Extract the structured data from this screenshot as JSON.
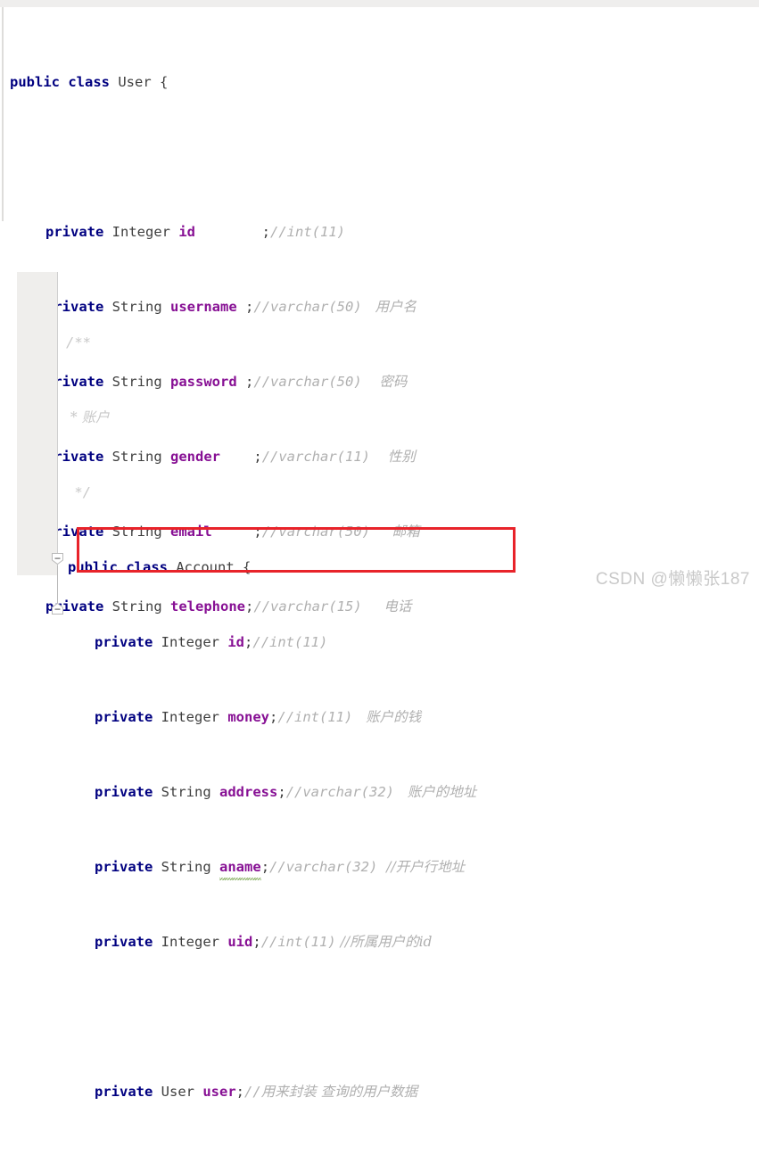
{
  "editor": {
    "language": "java",
    "watermark": "CSDN @懒懒张187",
    "accent_highlight_color": "#e8232a",
    "keyword_color": "#000080",
    "field_color": "#871094",
    "comment_color": "#b0b0b0",
    "gutter_color": "#efeeec"
  },
  "blocks": [
    {
      "id": "user-class",
      "class_name": "User",
      "lines": [
        {
          "id": "u-decl",
          "indent": 0,
          "keyword": "public class",
          "name": "User",
          "brace": " {"
        },
        {
          "id": "u-blank",
          "indent": 0,
          "text": ""
        },
        {
          "id": "u-id",
          "indent": 1,
          "keyword": "private",
          "type": "Integer",
          "field": "id",
          "pad": "        ",
          "semi": ";",
          "comment": "//int(11)",
          "comment_cn": ""
        },
        {
          "id": "u-username",
          "indent": 1,
          "keyword": "private",
          "type": "String",
          "field": "username",
          "pad": " ",
          "semi": ";",
          "comment": "//varchar(50)",
          "comment_cn": "用户名"
        },
        {
          "id": "u-password",
          "indent": 1,
          "keyword": "private",
          "type": "String",
          "field": "password",
          "pad": " ",
          "semi": ";",
          "comment": "//varchar(50)",
          "comment_cn": "密码"
        },
        {
          "id": "u-gender",
          "indent": 1,
          "keyword": "private",
          "type": "String",
          "field": "gender",
          "pad": "    ",
          "semi": ";",
          "comment": "//varchar(11)",
          "comment_cn": "性别"
        },
        {
          "id": "u-email",
          "indent": 1,
          "keyword": "private",
          "type": "String",
          "field": "email",
          "pad": "     ",
          "semi": ";",
          "comment": "//varchar(50)",
          "comment_cn": "邮箱"
        },
        {
          "id": "u-telephone",
          "indent": 1,
          "keyword": "private",
          "type": "String",
          "field": "telephone",
          "pad": "",
          "semi": ";",
          "comment": "//varchar(15)",
          "comment_cn": "电话"
        }
      ]
    },
    {
      "id": "account-class",
      "class_name": "Account",
      "javadoc": [
        "/**",
        " * 账户",
        " */"
      ],
      "fold_markers": [
        {
          "id": "fold-open",
          "type": "fold-open-icon",
          "state": "expanded"
        },
        {
          "id": "fold-close",
          "type": "fold-close-icon",
          "state": "expanded"
        }
      ],
      "lines": [
        {
          "id": "a-decl",
          "indent": 0,
          "keyword": "public class",
          "name": "Account",
          "brace": " {"
        },
        {
          "id": "a-id",
          "indent": 1,
          "keyword": "private",
          "type": "Integer",
          "field": "id",
          "semi": ";",
          "comment": "//int(11)",
          "comment_cn": ""
        },
        {
          "id": "a-money",
          "indent": 1,
          "keyword": "private",
          "type": "Integer",
          "field": "money",
          "semi": ";",
          "comment": "//int(11)",
          "comment_cn": "账户的钱"
        },
        {
          "id": "a-address",
          "indent": 1,
          "keyword": "private",
          "type": "String",
          "field": "address",
          "semi": ";",
          "comment": "//varchar(32)",
          "comment_cn": "账户的地址"
        },
        {
          "id": "a-aname",
          "indent": 1,
          "keyword": "private",
          "type": "String",
          "field": "aname",
          "semi": ";",
          "comment": "//varchar(32)",
          "comment_cn": "//开户行地址",
          "spellcheck_warning": true
        },
        {
          "id": "a-uid",
          "indent": 1,
          "keyword": "private",
          "type": "Integer",
          "field": "uid",
          "semi": ";",
          "comment": "//int(11)",
          "comment_cn": "//所属用户的id"
        },
        {
          "id": "a-blank",
          "indent": 0,
          "text": ""
        },
        {
          "id": "a-user",
          "indent": 1,
          "keyword": "private",
          "type": "User",
          "field": "user",
          "semi": ";",
          "comment": "//",
          "comment_cn": "用来封装 查询的用户数据",
          "highlighted": true
        }
      ]
    }
  ]
}
